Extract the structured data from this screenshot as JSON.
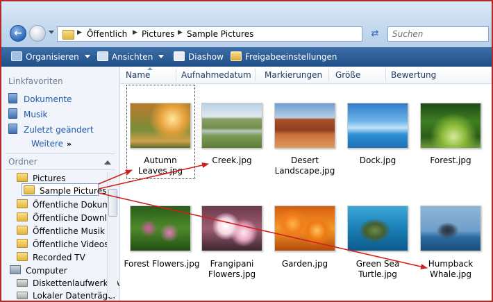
{
  "address": {
    "crumbs": [
      "Öffentlich",
      "Pictures",
      "Sample Pictures"
    ],
    "search_placeholder": "Suchen"
  },
  "toolbar": {
    "organize": "Organisieren",
    "views": "Ansichten",
    "slideshow": "Diashow",
    "share": "Freigabeeinstellungen"
  },
  "left": {
    "favorites_title": "Linkfavoriten",
    "favorites": [
      "Dokumente",
      "Musik",
      "Zuletzt geändert"
    ],
    "more": "Weitere",
    "more_symbol": "»",
    "folders_title": "Ordner",
    "tree": [
      "Pictures",
      "Sample Pictures",
      "Öffentliche Dokume",
      "Öffentliche Downloa",
      "Öffentliche Musik",
      "Öffentliche Videos",
      "Recorded TV",
      "Computer",
      "Diskettenlaufwerk (A",
      "Lokaler Datenträger"
    ]
  },
  "columns": [
    "Name",
    "Aufnahmedatum",
    "Markierungen",
    "Größe",
    "Bewertung"
  ],
  "files": [
    {
      "name": "Autumn Leaves.jpg",
      "lines": [
        "Autumn",
        "Leaves.jpg"
      ]
    },
    {
      "name": "Creek.jpg",
      "lines": [
        "Creek.jpg"
      ]
    },
    {
      "name": "Desert Landscape.jpg",
      "lines": [
        "Desert",
        "Landscape.jpg"
      ]
    },
    {
      "name": "Dock.jpg",
      "lines": [
        "Dock.jpg"
      ]
    },
    {
      "name": "Forest.jpg",
      "lines": [
        "Forest.jpg"
      ]
    },
    {
      "name": "Forest Flowers.jpg",
      "lines": [
        "Forest Flowers.jpg"
      ]
    },
    {
      "name": "Frangipani Flowers.jpg",
      "lines": [
        "Frangipani",
        "Flowers.jpg"
      ]
    },
    {
      "name": "Garden.jpg",
      "lines": [
        "Garden.jpg"
      ]
    },
    {
      "name": "Green Sea Turtle.jpg",
      "lines": [
        "Green Sea",
        "Turtle.jpg"
      ]
    },
    {
      "name": "Humpback Whale.jpg",
      "lines": [
        "Humpback",
        "Whale.jpg"
      ]
    }
  ],
  "colors": {
    "accent": "#1d5aa8",
    "toolbar": "#2a5d96",
    "arrow": "#d01f1f",
    "frame": "#b22a2a"
  }
}
